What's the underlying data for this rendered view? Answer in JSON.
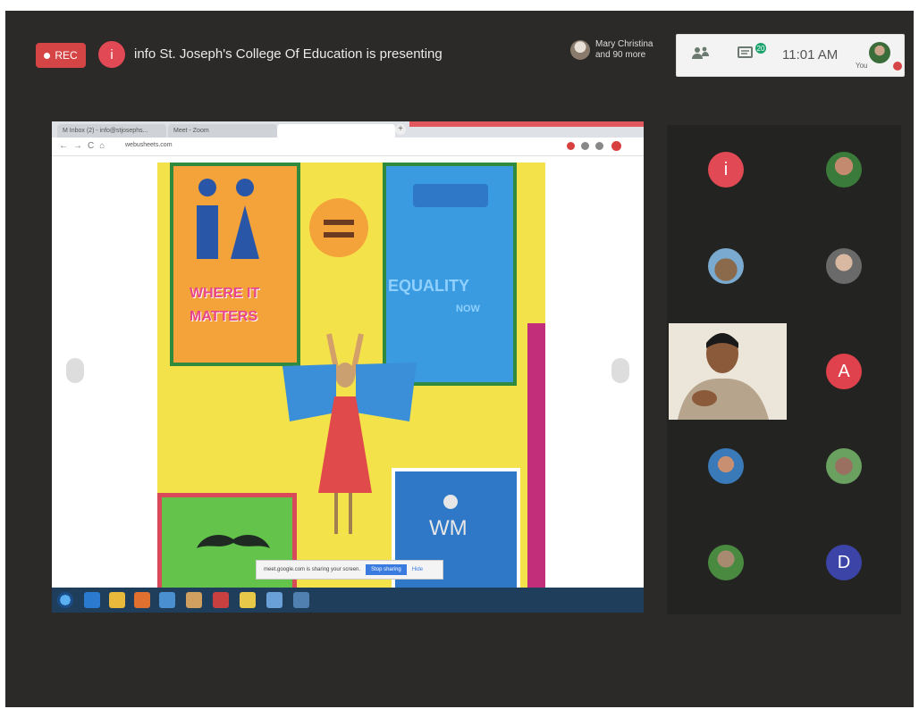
{
  "header": {
    "rec_label": "REC",
    "presenter_initial": "i",
    "presenter_text": "info St. Joseph's College Of Education is presenting",
    "people_line1": "Mary Christina",
    "people_line2": "and 90 more",
    "chat_badge": "20",
    "time": "11:01 AM",
    "you_label": "You"
  },
  "browser": {
    "tabs": [
      "M Inbox (2) - info@stjosephs...",
      "Meet - Zoom",
      ""
    ],
    "url": "webusheets.com"
  },
  "artwork": {
    "text_where": "WHERE IT",
    "text_matters": "MATTERS",
    "text_equality": "EQUALITY",
    "text_now": "NOW",
    "logo_wm": "WM"
  },
  "notification": {
    "text": "meet.google.com is sharing your screen.",
    "stop_label": "Stop sharing",
    "hide_label": "Hide"
  },
  "participants": {
    "initial_1": "i",
    "initial_a": "A",
    "initial_d": "D"
  },
  "colors": {
    "rec": "#d64545",
    "presenter": "#e14a54",
    "avatar_a": "#e0424d",
    "avatar_d": "#3c44a8",
    "meet_bg": "#2b2a28"
  }
}
